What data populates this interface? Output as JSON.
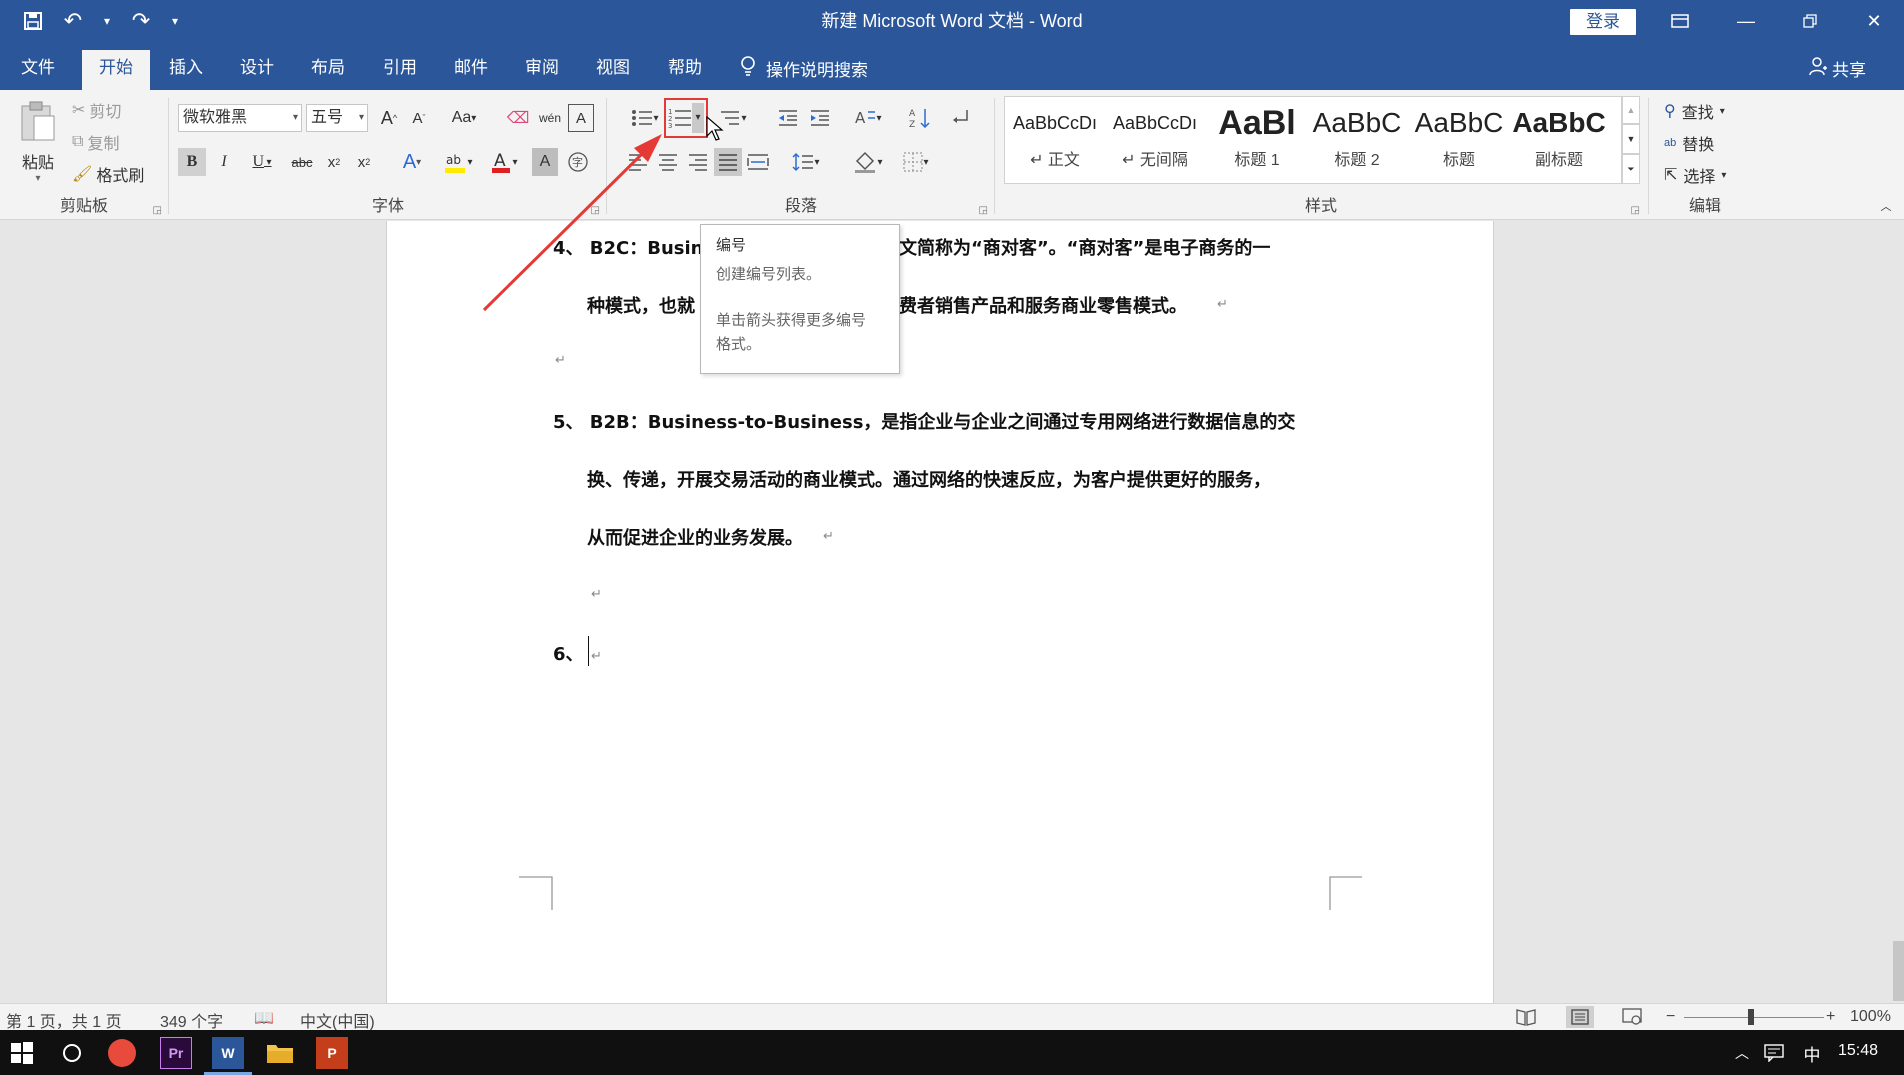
{
  "window": {
    "title": "新建 Microsoft Word 文档  -  Word",
    "login_label": "登录"
  },
  "tabs": [
    "文件",
    "开始",
    "插入",
    "设计",
    "布局",
    "引用",
    "邮件",
    "审阅",
    "视图",
    "帮助"
  ],
  "active_tab": "开始",
  "tell_me": "操作说明搜索",
  "share_label": "共享",
  "ribbon": {
    "clipboard": {
      "label": "剪贴板",
      "paste": "粘贴",
      "cut": "剪切",
      "copy": "复制",
      "format_painter": "格式刷"
    },
    "font": {
      "label": "字体",
      "font_name": "微软雅黑",
      "font_size": "五号",
      "change_case": "Aa"
    },
    "paragraph": {
      "label": "段落"
    },
    "styles": {
      "label": "样式",
      "items": [
        {
          "preview": "AaBbCcDı",
          "name": "↵ 正文"
        },
        {
          "preview": "AaBbCcDı",
          "name": "↵ 无间隔"
        },
        {
          "preview": "AaBl",
          "name": "标题 1"
        },
        {
          "preview": "AaBbC",
          "name": "标题 2"
        },
        {
          "preview": "AaBbC",
          "name": "标题"
        },
        {
          "preview": "AaBbC",
          "name": "副标题"
        }
      ]
    },
    "editing": {
      "label": "编辑",
      "find": "查找",
      "replace": "替换",
      "select": "选择"
    }
  },
  "tooltip": {
    "title": "编号",
    "line1": "创建编号列表。",
    "line2": "单击箭头获得更多编号",
    "line3": "格式。"
  },
  "document": {
    "lines": [
      "4、 B2C：Busin",
      "文简称为“商对客”。“商对客”是电子商务的一",
      "种模式，也就",
      "费者销售产品和服务商业零售模式。",
      "5、 B2B：Business-to-Business，是指企业与企业之间通过专用网络进行数据信息的交",
      "换、传递，开展交易活动的商业模式。通过网络的快速反应，为客户提供更好的服务，",
      "从而促进企业的业务发展。",
      "6、"
    ]
  },
  "status": {
    "page": "第 1 页，共 1 页",
    "words": "349 个字",
    "language": "中文(中国)",
    "zoom": "100%"
  },
  "taskbar": {
    "word_label": "W",
    "ppt_label": "P",
    "pr_label": "Pr",
    "ime": "中",
    "time": "15:48"
  },
  "colors": {
    "title_blue": "#2b579a",
    "highlight_red": "#e53935",
    "arrow_red": "#e53935"
  }
}
